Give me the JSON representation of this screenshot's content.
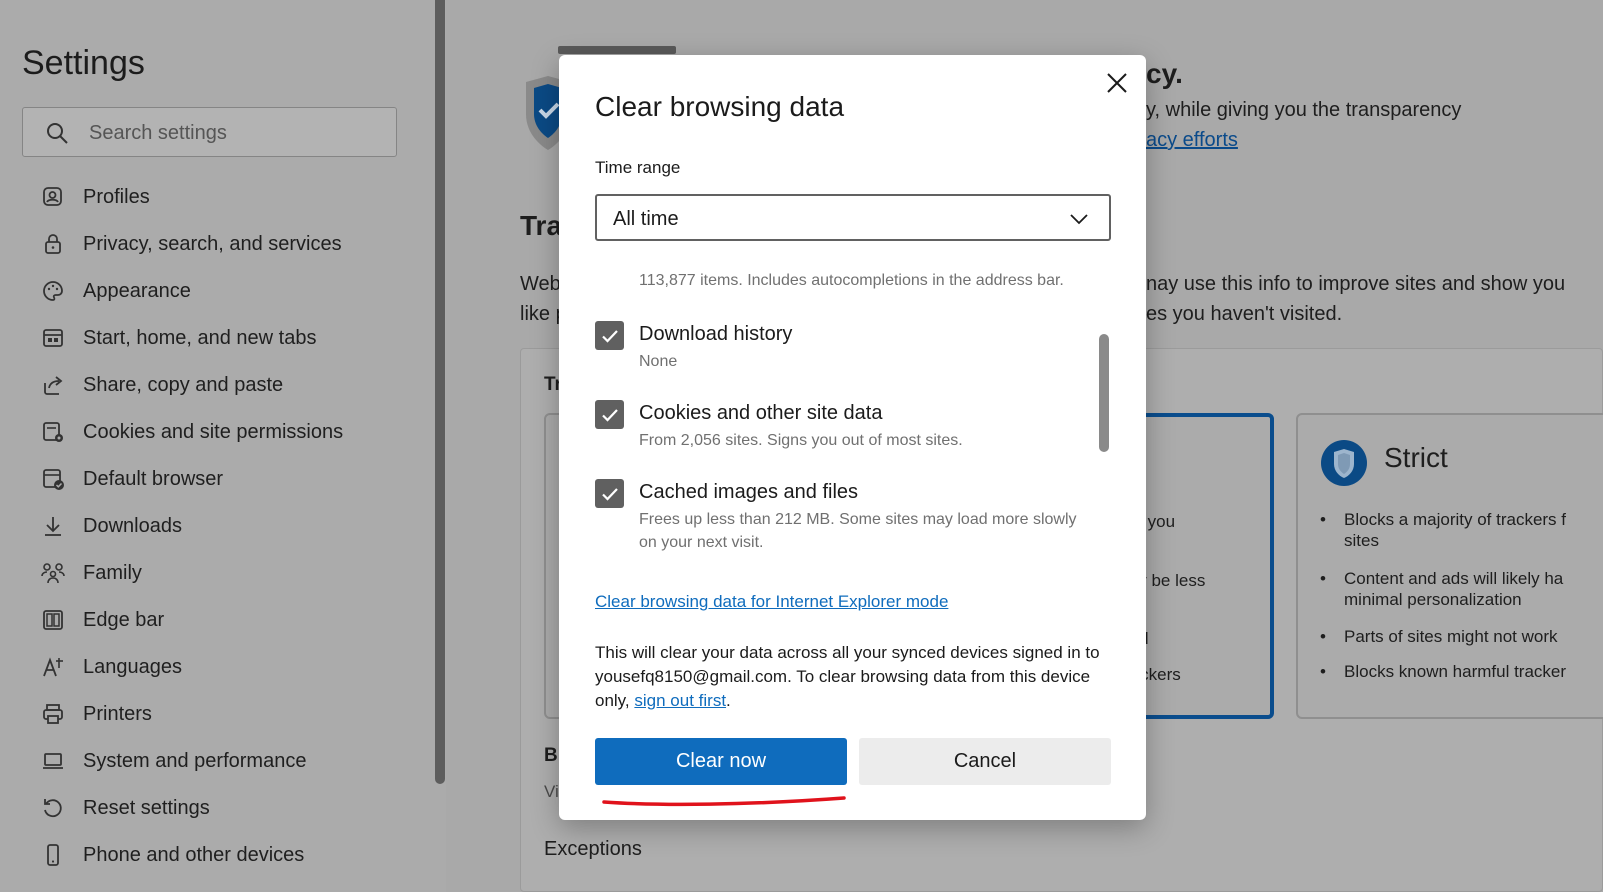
{
  "sidebar": {
    "title": "Settings",
    "search_placeholder": "Search settings",
    "items": [
      {
        "label": "Profiles",
        "icon": "profiles-icon"
      },
      {
        "label": "Privacy, search, and services",
        "icon": "lock-icon"
      },
      {
        "label": "Appearance",
        "icon": "palette-icon"
      },
      {
        "label": "Start, home, and new tabs",
        "icon": "start-page-icon"
      },
      {
        "label": "Share, copy and paste",
        "icon": "share-icon"
      },
      {
        "label": "Cookies and site permissions",
        "icon": "cookies-icon"
      },
      {
        "label": "Default browser",
        "icon": "default-browser-icon"
      },
      {
        "label": "Downloads",
        "icon": "download-icon"
      },
      {
        "label": "Family",
        "icon": "family-icon"
      },
      {
        "label": "Edge bar",
        "icon": "edge-bar-icon"
      },
      {
        "label": "Languages",
        "icon": "languages-icon"
      },
      {
        "label": "Printers",
        "icon": "printer-icon"
      },
      {
        "label": "System and performance",
        "icon": "laptop-icon"
      },
      {
        "label": "Reset settings",
        "icon": "reset-icon"
      },
      {
        "label": "Phone and other devices",
        "icon": "phone-icon"
      }
    ]
  },
  "background": {
    "heading_fragment": "cy.",
    "intro_line": "y, while giving you the transparency",
    "intro_link": "acy efforts",
    "section_fragment": "Tra",
    "para_left_1": "Web",
    "para_left_2": "like p",
    "para_right_1": "nay use this info to improve sites and show you",
    "para_right_2": "es you haven't visited.",
    "panel_fragment": "Tr",
    "blocked_fragment": "Bl",
    "blocked_sub_fragment": "Vi",
    "exceptions": "Exceptions",
    "balanced_fragments": [
      "es you",
      "ely be less",
      "ted",
      "rackers"
    ],
    "strict": {
      "title": "Strict",
      "bullets": [
        "Blocks a majority of trackers f",
        "sites",
        "Content and ads will likely ha",
        "minimal personalization",
        "Parts of sites might not work",
        "Blocks known harmful tracker"
      ]
    }
  },
  "dialog": {
    "title": "Clear browsing data",
    "time_range_label": "Time range",
    "time_range_value": "All time",
    "browsing_history_desc": "113,877 items. Includes autocompletions in the address bar.",
    "items": [
      {
        "title": "Download history",
        "desc": "None",
        "checked": true
      },
      {
        "title": "Cookies and other site data",
        "desc": "From 2,056 sites. Signs you out of most sites.",
        "checked": true
      },
      {
        "title": "Cached images and files",
        "desc": "Frees up less than 212 MB. Some sites may load more slowly on your next visit.",
        "checked": true
      }
    ],
    "ie_link": "Clear browsing data for Internet Explorer mode",
    "sync_note_text": "This will clear your data across all your synced devices signed in to yousefq8150@gmail.com. To clear browsing data from this device only,",
    "sync_note_link": "sign out first",
    "sync_note_end": ".",
    "clear_button": "Clear now",
    "cancel_button": "Cancel"
  },
  "colors": {
    "accent": "#0f6cbd",
    "annotation": "#e0121b",
    "overlay": "#a9a9a9"
  }
}
